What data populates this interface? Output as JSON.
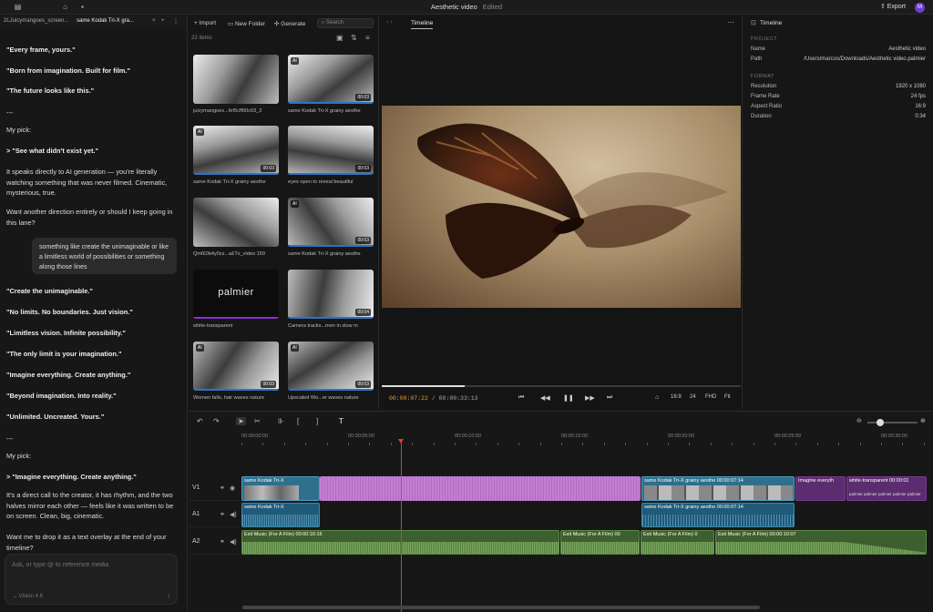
{
  "app": {
    "title": "Aesthetic video",
    "status": "Edited",
    "export_label": "Export",
    "user_initial": "M"
  },
  "chat": {
    "tabs": [
      "2LJuicymangoes_screen...",
      "same Kodak Tri-X gra..."
    ],
    "messages": [
      {
        "text": "\"Every frame, yours.\"",
        "bold": true
      },
      {
        "text": "\"Born from imagination. Built for film.\"",
        "bold": true
      },
      {
        "text": "\"The future looks like this.\"",
        "bold": true
      },
      {
        "text": "---",
        "bold": false
      },
      {
        "text": "My pick:",
        "bold": false
      },
      {
        "text": "> \"See what didn't exist yet.\"",
        "bold": true
      },
      {
        "text": "It speaks directly to AI generation — you're literally watching something that was never filmed. Cinematic, mysterious, true.",
        "bold": false
      },
      {
        "text": "Want another direction entirely or should I keep going in this lane?",
        "bold": false
      },
      {
        "text": "\"Create the unimaginable.\"",
        "bold": true
      },
      {
        "text": "\"No limits. No boundaries. Just vision.\"",
        "bold": true
      },
      {
        "text": "\"Limitless vision. Infinite possibility.\"",
        "bold": true
      },
      {
        "text": "\"The only limit is your imagination.\"",
        "bold": true
      },
      {
        "text": "\"Imagine everything. Create anything.\"",
        "bold": true
      },
      {
        "text": "\"Beyond imagination. Into reality.\"",
        "bold": true
      },
      {
        "text": "\"Unlimited. Uncreated. Yours.\"",
        "bold": true
      },
      {
        "text": "---",
        "bold": false
      },
      {
        "text": "My pick:",
        "bold": false
      },
      {
        "text": "> \"Imagine everything. Create anything.\"",
        "bold": true
      },
      {
        "text": "It's a direct call to the creator, it has rhythm, and the two halves mirror each other — feels like it was written to be on screen. Clean, big, cinematic.",
        "bold": false
      },
      {
        "text": "Want me to drop it as a text overlay at the end of your timeline?",
        "bold": false
      }
    ],
    "user_message": "something like create the unimaginable or like a limitless world of possibilities or something along those lines",
    "input_placeholder": "Ask, or type @ to reference media",
    "model": "Vision 4.6"
  },
  "media": {
    "toolbar": {
      "import": "Import",
      "new_folder": "New Folder",
      "generate": "Generate",
      "search_placeholder": "Search"
    },
    "count": "22 items",
    "items": [
      {
        "caption": "juicymangoes...fef5cff00c03_2",
        "ai": false,
        "duration": ""
      },
      {
        "caption": "same Kodak Tri-X grainy aesthe",
        "ai": true,
        "duration": "00:03"
      },
      {
        "caption": "same Kodak Tri-X grainy aesthe",
        "ai": true,
        "duration": "00:03"
      },
      {
        "caption": "eyes open to reveal beautiful",
        "ai": false,
        "duration": "00:03"
      },
      {
        "caption": "Qmf£0b4y0zz...a£Tx_video 159",
        "ai": false,
        "duration": ""
      },
      {
        "caption": "same Kodak Tri-X grainy aesthe",
        "ai": true,
        "duration": "00:03"
      },
      {
        "caption": "white-transparent",
        "ai": false,
        "duration": "",
        "logo_text": "palmier"
      },
      {
        "caption": "Camera tracks...men in slow m",
        "ai": false,
        "duration": "00:04"
      },
      {
        "caption": "Women falls, hair waves nature",
        "ai": true,
        "duration": "00:03"
      },
      {
        "caption": "Upscaled Wo...er waves nature",
        "ai": true,
        "duration": "00:03"
      }
    ]
  },
  "preview": {
    "tab": "Timeline",
    "current_time": "00:00:07:22",
    "total_time": "00:00:33:13",
    "progress": 0.23,
    "controls": {
      "ratio": "16:9",
      "fps": "24",
      "quality": "FHD",
      "fit": "Fit"
    }
  },
  "properties": {
    "title": "Timeline",
    "project_section": "PROJECT",
    "format_section": "FORMAT",
    "name_label": "Name",
    "name_value": "Aesthetic video",
    "path_label": "Path",
    "path_value": "/Users/marcos/Downloads/Aesthetic video.palmier",
    "resolution_label": "Resolution",
    "resolution_value": "1920 x 1080",
    "framerate_label": "Frame Rate",
    "framerate_value": "24 fps",
    "aspect_label": "Aspect Ratio",
    "aspect_value": "16:9",
    "duration_label": "Duration",
    "duration_value": "0:34"
  },
  "timeline": {
    "ruler": [
      "00:00:00:00",
      "00:00:05:00",
      "00:00:10:00",
      "00:00:15:00",
      "00:00:20:00",
      "00:00:25:00",
      "00:00:30:00"
    ],
    "tracks": [
      "V1",
      "A1",
      "A2"
    ],
    "clips": {
      "v1_a": "same Kodak Tri-X",
      "v1_c": "same Kodak Tri-X grainy aesthe  00:00:07:14",
      "v1_d": "Imagine everyth",
      "v1_e": "white-transparent  00:00:01",
      "v1_e_sub": "palmier  palmier  palmier  palmier  palmier",
      "a1_a": "same Kodak Tri-X",
      "a1_b": "same Kodak Tri-X grainy aesthe  00:00:07:14",
      "a2_a": "Exit Music (For A Film)  00:00:16:16",
      "a2_b": "Exit Music (For A Film)  00",
      "a2_c": "Exit Music (For A Film)  0",
      "a2_d": "Exit Music (For A Film)  00:00:10:07"
    }
  }
}
